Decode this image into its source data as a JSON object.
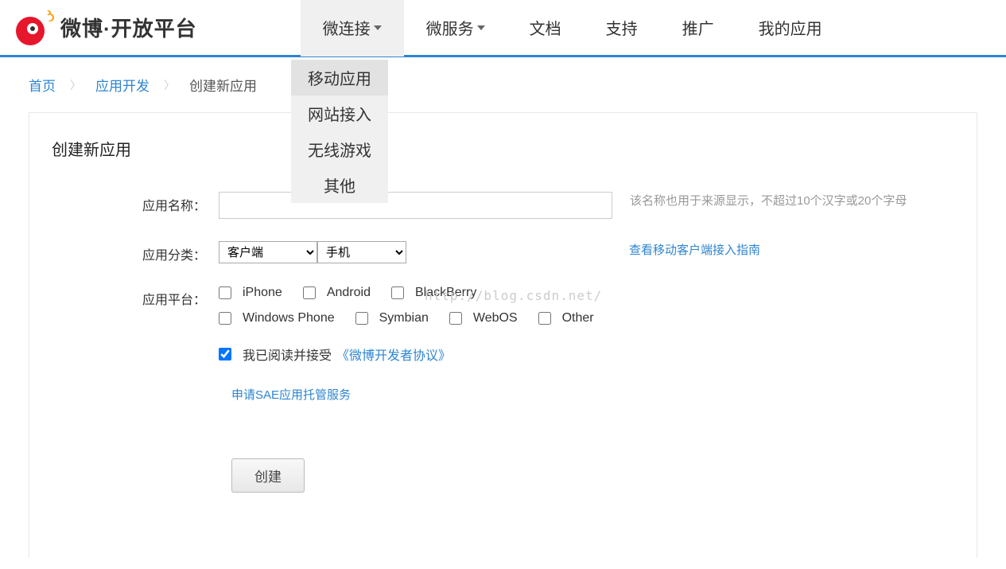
{
  "logo_text": "微博·开放平台",
  "nav": {
    "items": [
      {
        "label": "微连接",
        "has_dropdown": true,
        "active": true
      },
      {
        "label": "微服务",
        "has_dropdown": true
      },
      {
        "label": "文档"
      },
      {
        "label": "支持"
      },
      {
        "label": "推广"
      },
      {
        "label": "我的应用"
      }
    ]
  },
  "dropdown": {
    "items": [
      "移动应用",
      "网站接入",
      "无线游戏",
      "其他"
    ]
  },
  "breadcrumb": {
    "home": "首页",
    "dev": "应用开发",
    "current": "创建新应用"
  },
  "page_title": "创建新应用",
  "form": {
    "name_label": "应用名称：",
    "name_value": "",
    "name_hint": "该名称也用于来源显示，不超过10个汉字或20个字母",
    "category_label": "应用分类：",
    "category_value": "客户端",
    "subcategory_value": "手机",
    "category_link": "查看移动客户端接入指南",
    "platform_label": "应用平台：",
    "platforms": [
      "iPhone",
      "Android",
      "BlackBerry",
      "Windows Phone",
      "Symbian",
      "WebOS",
      "Other"
    ],
    "agreement_text": "我已阅读并接受",
    "agreement_link": "《微博开发者协议》",
    "agreement_checked": true,
    "sae_link": "申请SAE应用托管服务",
    "submit": "创建"
  },
  "watermark": "http://blog.csdn.net/"
}
